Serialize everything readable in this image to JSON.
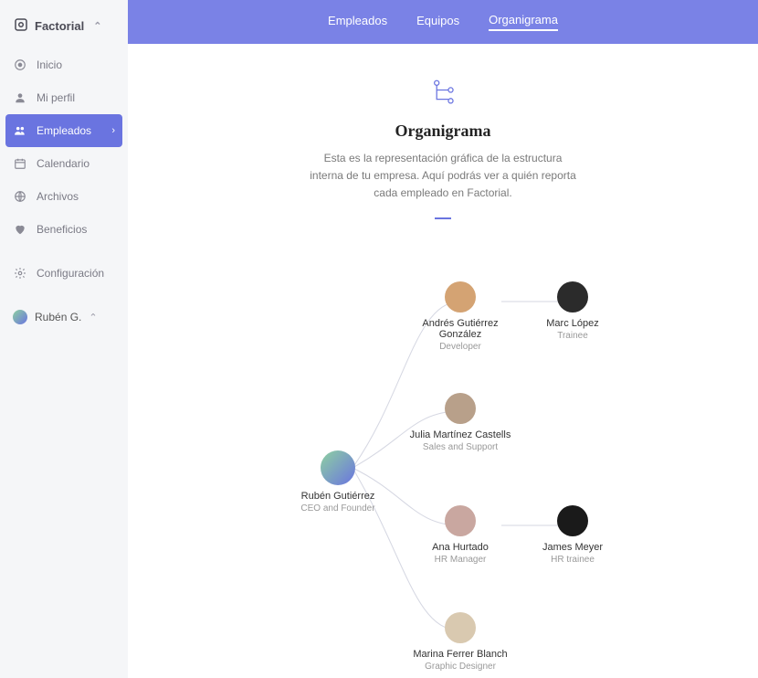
{
  "brand": {
    "name": "Factorial"
  },
  "sidebar": [
    {
      "id": "inicio",
      "label": "Inicio",
      "icon": "home"
    },
    {
      "id": "miperfil",
      "label": "Mi perfil",
      "icon": "person"
    },
    {
      "id": "empleados",
      "label": "Empleados",
      "icon": "people",
      "active": true
    },
    {
      "id": "calendario",
      "label": "Calendario",
      "icon": "calendar"
    },
    {
      "id": "archivos",
      "label": "Archivos",
      "icon": "globe"
    },
    {
      "id": "beneficios",
      "label": "Beneficios",
      "icon": "heart"
    }
  ],
  "sidebar_config": {
    "label": "Configuración"
  },
  "sidebar_user": {
    "name": "Rubén G."
  },
  "tabs": [
    {
      "id": "empleados",
      "label": "Empleados"
    },
    {
      "id": "equipos",
      "label": "Equipos"
    },
    {
      "id": "organigrama",
      "label": "Organigrama",
      "active": true
    }
  ],
  "page": {
    "title": "Organigrama",
    "description": "Esta es la representación gráfica de la estructura interna de tu empresa. Aquí podrás ver a quién reporta cada empleado en Factorial."
  },
  "orgchart": {
    "root": {
      "name": "Rubén Gutiérrez",
      "role": "CEO and Founder"
    },
    "nodes": [
      {
        "name": "Andrés Gutiérrez González",
        "role": "Developer",
        "children": [
          {
            "name": "Marc López",
            "role": "Trainee"
          }
        ]
      },
      {
        "name": "Julia Martínez Castells",
        "role": "Sales and Support"
      },
      {
        "name": "Ana Hurtado",
        "role": "HR Manager",
        "children": [
          {
            "name": "James Meyer",
            "role": "HR trainee"
          }
        ]
      },
      {
        "name": "Marina Ferrer Blanch",
        "role": "Graphic Designer"
      }
    ]
  }
}
